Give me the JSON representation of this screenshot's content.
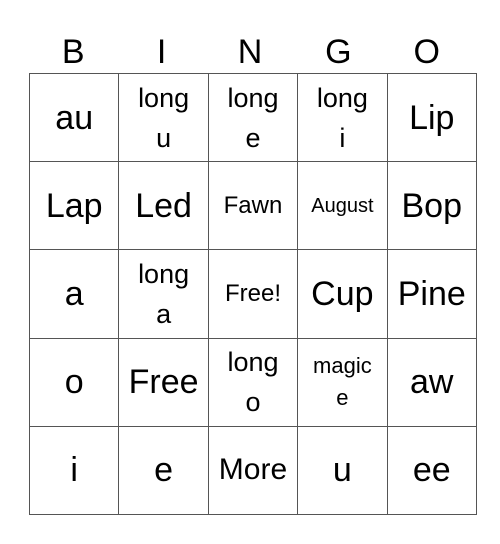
{
  "header": {
    "letters": [
      "B",
      "I",
      "N",
      "G",
      "O"
    ]
  },
  "grid": {
    "rows": [
      [
        "au",
        "long\nu",
        "long\ne",
        "long\ni",
        "Lip"
      ],
      [
        "Lap",
        "Led",
        "Fawn",
        "August",
        "Bop"
      ],
      [
        "a",
        "long\na",
        "Free!",
        "Cup",
        "Pine"
      ],
      [
        "o",
        "Free",
        "long\no",
        "magic\ne",
        "aw"
      ],
      [
        "i",
        "e",
        "More",
        "u",
        "ee"
      ]
    ],
    "size_classes": [
      [
        "sz-xl",
        "sz-w2",
        "sz-w2",
        "sz-w2",
        "sz-xl"
      ],
      [
        "sz-xl",
        "sz-xl",
        "sz-s",
        "sz-xs",
        "sz-xl"
      ],
      [
        "sz-xl",
        "sz-w2",
        "sz-s",
        "sz-xl",
        "sz-xl"
      ],
      [
        "sz-xl",
        "sz-xl",
        "sz-w2",
        "sz-w2s",
        "sz-xl"
      ],
      [
        "sz-xl",
        "sz-xl",
        "sz-l",
        "sz-xl",
        "sz-xl"
      ]
    ]
  }
}
